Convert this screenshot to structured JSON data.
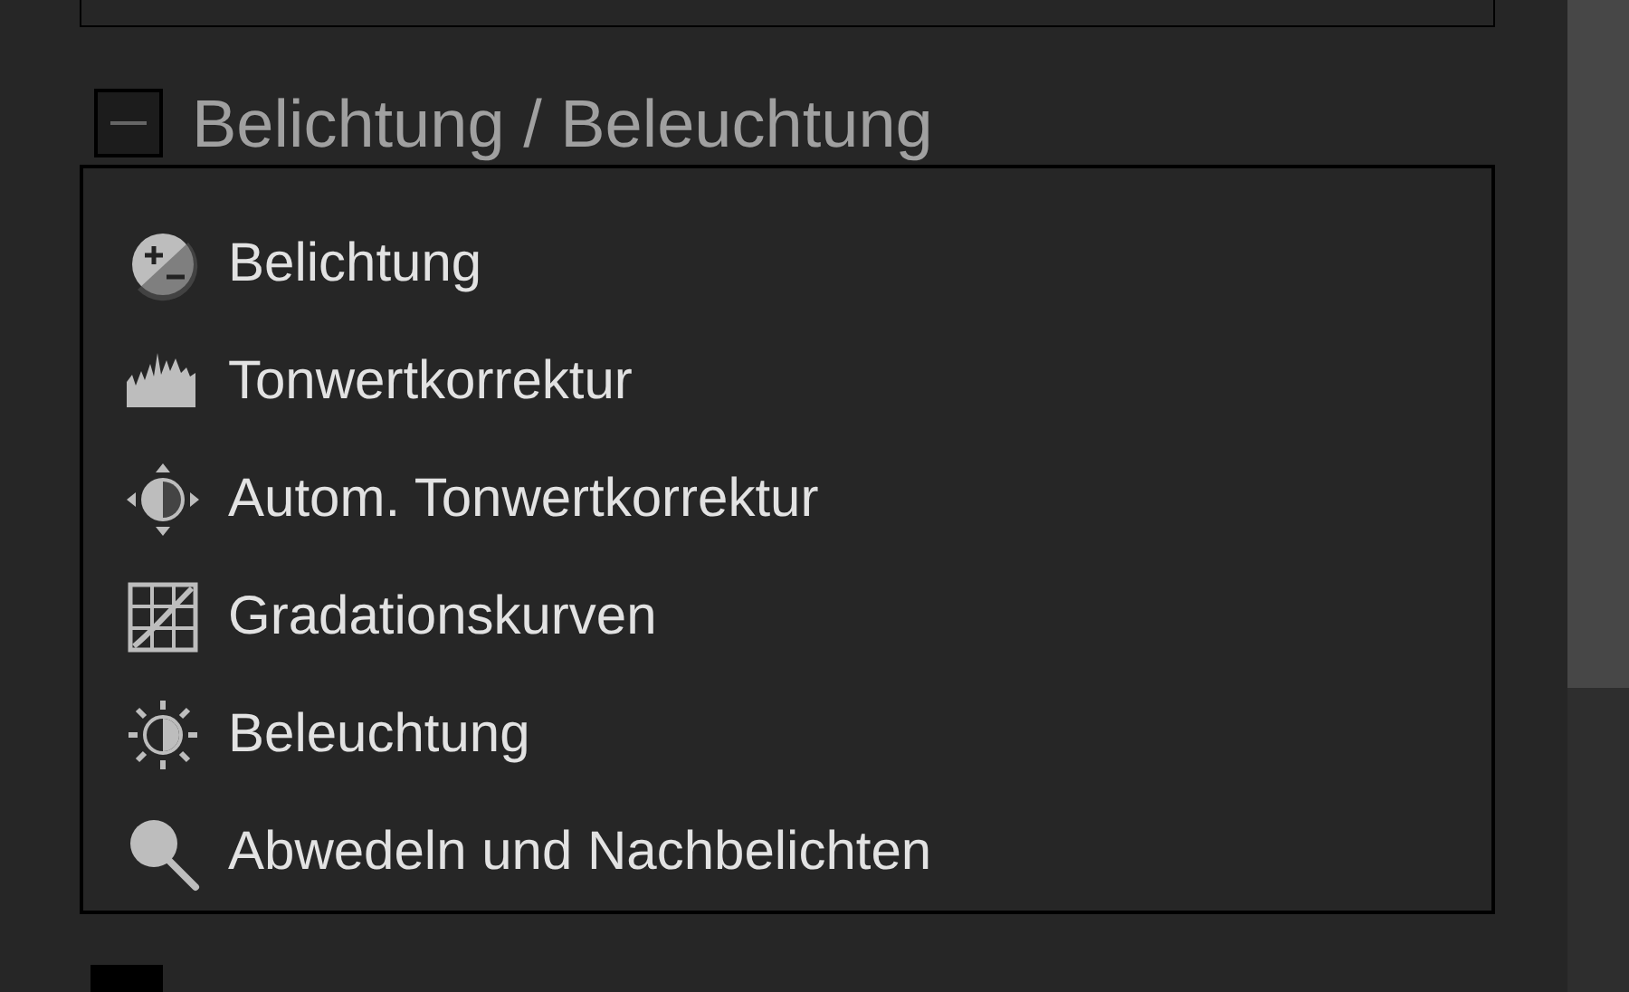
{
  "section": {
    "title": "Belichtung / Beleuchtung",
    "expanded": true,
    "items": [
      {
        "kind": "exposure",
        "label": "Belichtung"
      },
      {
        "kind": "levels",
        "label": "Tonwertkorrektur"
      },
      {
        "kind": "auto-levels",
        "label": "Autom. Tonwertkorrektur"
      },
      {
        "kind": "curves",
        "label": "Gradationskurven"
      },
      {
        "kind": "lighting",
        "label": "Beleuchtung"
      },
      {
        "kind": "dodge",
        "label": "Abwedeln und Nachbelichten"
      }
    ]
  }
}
